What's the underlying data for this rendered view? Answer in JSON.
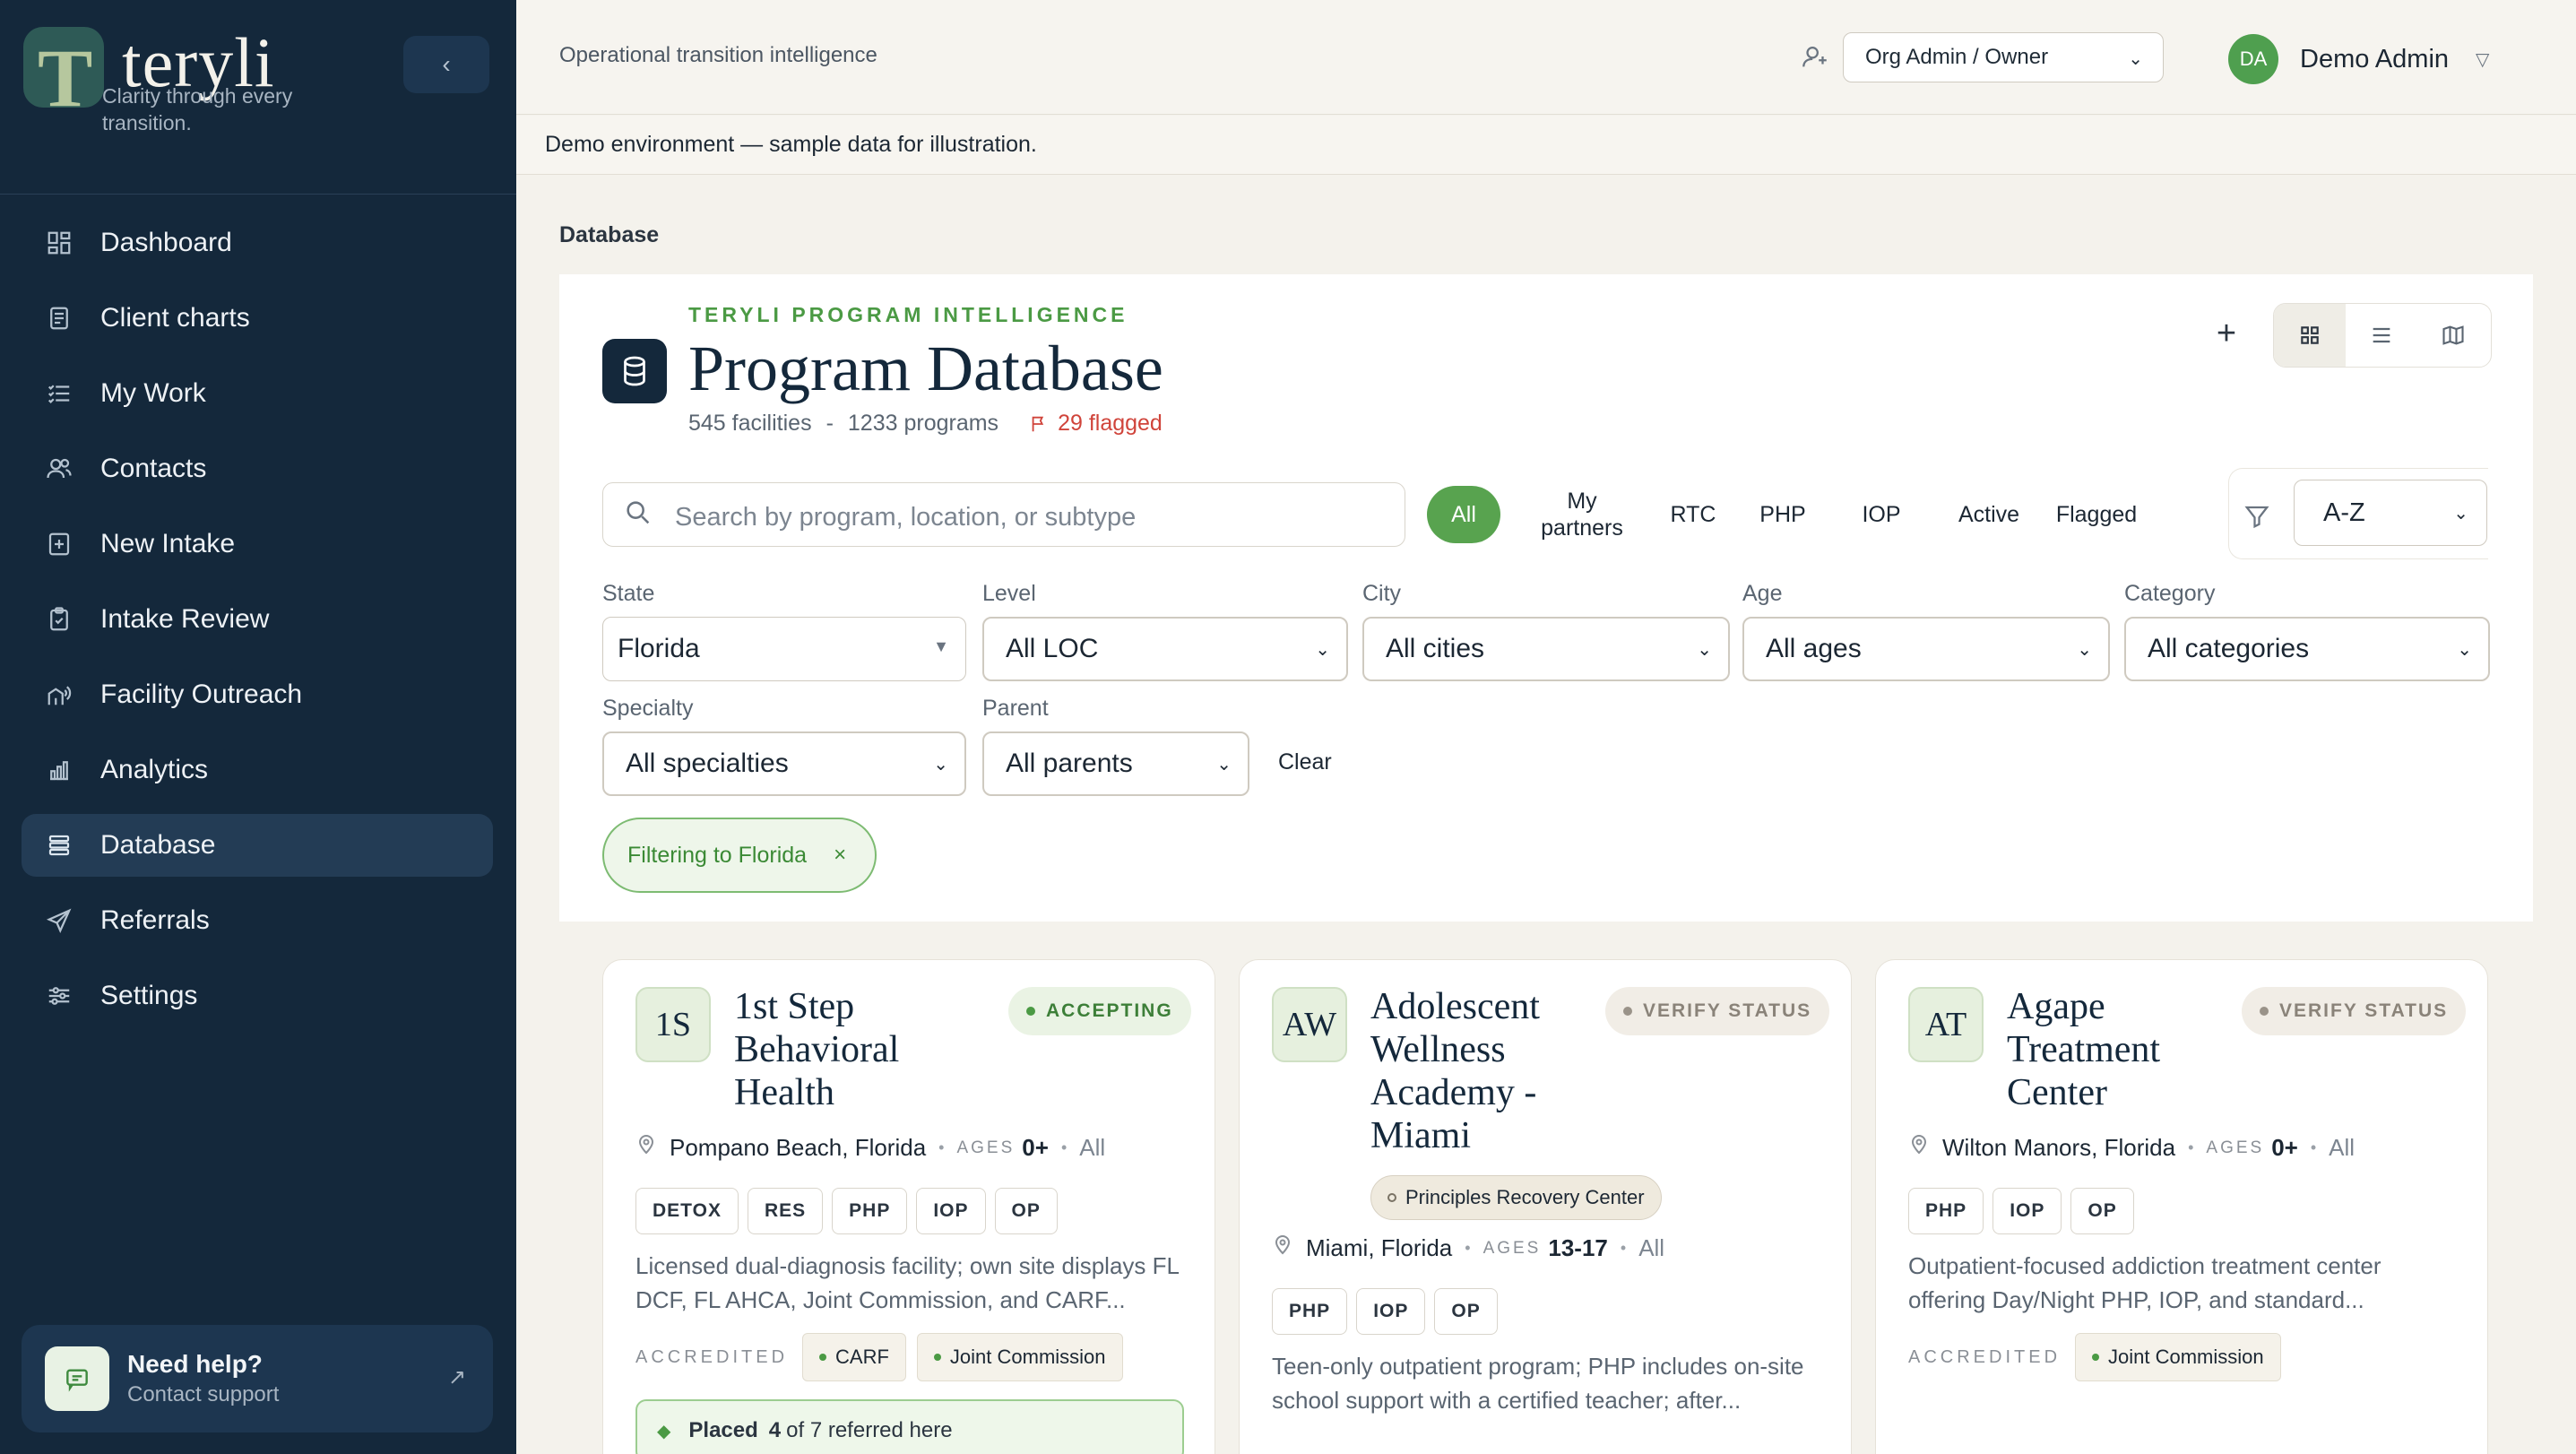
{
  "brand": {
    "name": "teryli",
    "tagline": "Clarity through every transition."
  },
  "sidebar": {
    "items": [
      {
        "label": "Dashboard",
        "icon": "dashboard-icon"
      },
      {
        "label": "Client charts",
        "icon": "document-icon"
      },
      {
        "label": "My Work",
        "icon": "checklist-icon"
      },
      {
        "label": "Contacts",
        "icon": "contacts-icon"
      },
      {
        "label": "New Intake",
        "icon": "plus-square-icon"
      },
      {
        "label": "Intake Review",
        "icon": "clipboard-check-icon"
      },
      {
        "label": "Facility Outreach",
        "icon": "outreach-icon"
      },
      {
        "label": "Analytics",
        "icon": "bar-chart-icon"
      },
      {
        "label": "Database",
        "icon": "database-icon",
        "active": true
      },
      {
        "label": "Referrals",
        "icon": "send-icon"
      },
      {
        "label": "Settings",
        "icon": "sliders-icon"
      }
    ],
    "help": {
      "title": "Need help?",
      "subtitle": "Contact support"
    }
  },
  "topbar": {
    "title": "Operational transition intelligence",
    "role": "Org Admin / Owner",
    "user": {
      "initials": "DA",
      "name": "Demo Admin"
    }
  },
  "banner": "Demo environment — sample data for illustration.",
  "breadcrumb": "Database",
  "panel": {
    "eyebrow": "TERYLI PROGRAM INTELLIGENCE",
    "title": "Program Database",
    "facilities": "545 facilities",
    "separator": "-",
    "programs": "1233 programs",
    "flagged": "29 flagged",
    "search_placeholder": "Search by program, location, or subtype",
    "chips": {
      "all": "All",
      "my_partners": "My partners",
      "rtc": "RTC",
      "php": "PHP",
      "iop": "IOP",
      "active": "Active",
      "flagged": "Flagged"
    },
    "sort": "A-Z",
    "filters": {
      "state": {
        "label": "State",
        "value": "Florida"
      },
      "level": {
        "label": "Level",
        "value": "All LOC"
      },
      "city": {
        "label": "City",
        "value": "All cities"
      },
      "age": {
        "label": "Age",
        "value": "All ages"
      },
      "category": {
        "label": "Category",
        "value": "All categories"
      },
      "specialty": {
        "label": "Specialty",
        "value": "All specialties"
      },
      "parent": {
        "label": "Parent",
        "value": "All parents"
      }
    },
    "clear": "Clear",
    "active_filter": "Filtering to Florida"
  },
  "cards": [
    {
      "initials": "1S",
      "name_lines": [
        "1st Step",
        "Behavioral",
        "Health"
      ],
      "status": "ACCEPTING",
      "location": "Pompano Beach, Florida",
      "ages_label": "AGES",
      "ages": "0+",
      "gender": "All",
      "tags": [
        "DETOX",
        "RES",
        "PHP",
        "IOP",
        "OP"
      ],
      "description": "Licensed dual-diagnosis facility; own site displays FL DCF, FL AHCA, Joint Commission, and CARF...",
      "accredited_label": "ACCREDITED",
      "accreditations": [
        "CARF",
        "Joint Commission"
      ],
      "placed": {
        "prefix": "Placed",
        "count": "4",
        "suffix": "of 7 referred here"
      }
    },
    {
      "initials": "AW",
      "name_lines": [
        "Adolescent",
        "Wellness",
        "Academy -",
        "Miami"
      ],
      "status": "VERIFY STATUS",
      "parent": "Principles Recovery Center",
      "location": "Miami, Florida",
      "ages_label": "AGES",
      "ages": "13-17",
      "gender": "All",
      "tags": [
        "PHP",
        "IOP",
        "OP"
      ],
      "description": "Teen-only outpatient program; PHP includes on-site school support with a certified teacher; after..."
    },
    {
      "initials": "AT",
      "name_lines": [
        "Agape",
        "Treatment",
        "Center"
      ],
      "status": "VERIFY STATUS",
      "location": "Wilton Manors, Florida",
      "ages_label": "AGES",
      "ages": "0+",
      "gender": "All",
      "tags": [
        "PHP",
        "IOP",
        "OP"
      ],
      "description": "Outpatient-focused addiction treatment center offering Day/Night PHP, IOP, and standard...",
      "accredited_label": "ACCREDITED",
      "accreditations": [
        "Joint Commission"
      ]
    }
  ],
  "colors": {
    "sidebar": "#14283b",
    "accent": "#58a34f",
    "flag": "#d0443b"
  }
}
